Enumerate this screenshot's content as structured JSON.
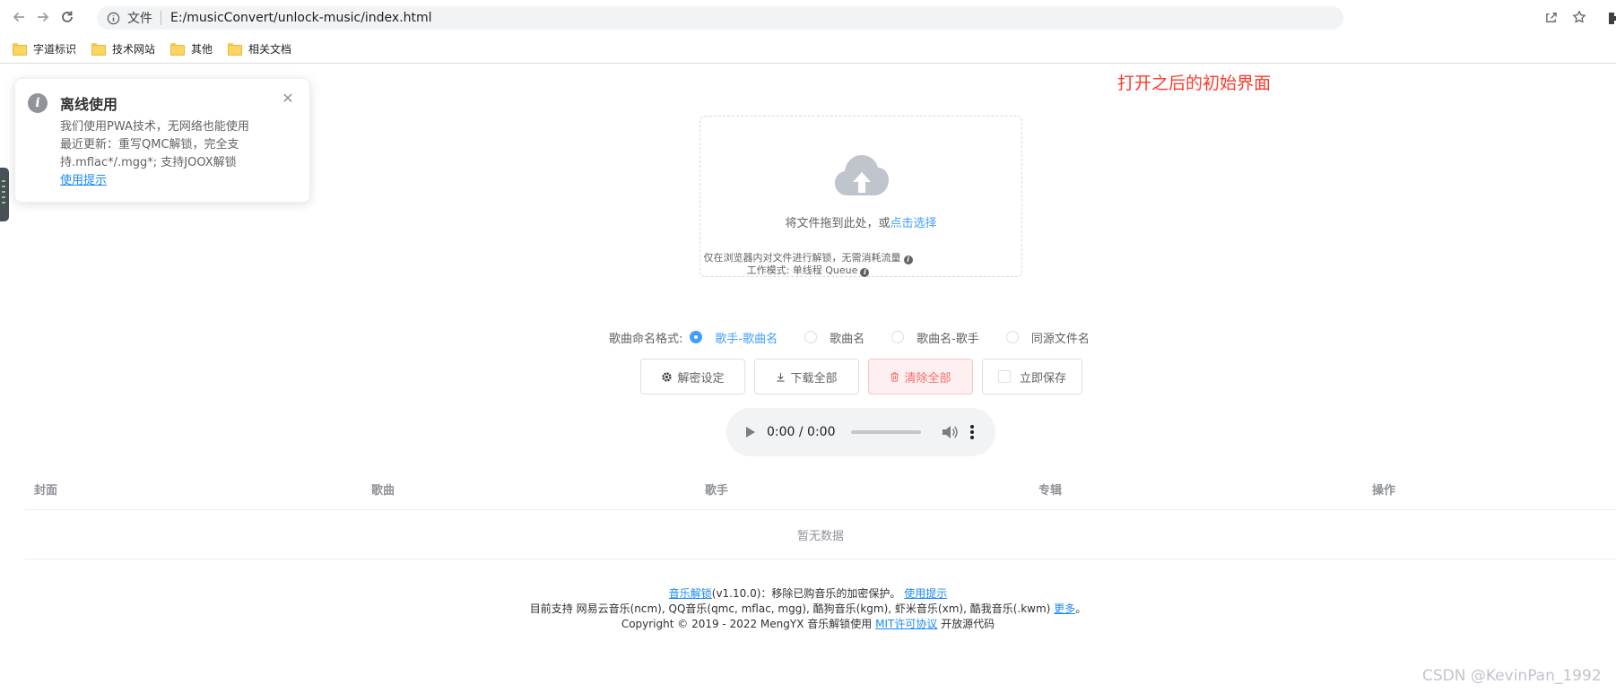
{
  "browser": {
    "scheme_tag": "文件",
    "url": "E:/musicConvert/unlock-music/index.html",
    "bookmarks": [
      "字道标识",
      "技术网站",
      "其他",
      "相关文档"
    ]
  },
  "annotation": "打开之后的初始界面",
  "notification": {
    "title": "离线使用",
    "line1": "我们使用PWA技术，无网络也能使用",
    "line2": "最近更新：重写QMC解锁，完全支持.mflac*/.mgg*; 支持JOOX解锁",
    "link": "使用提示"
  },
  "upload": {
    "text": "将文件拖到此处，或",
    "link": "点击选择"
  },
  "tips": {
    "local": "仅在浏览器内对文件进行解锁，无需消耗流量",
    "mode": "工作模式: 单线程 Queue"
  },
  "naming": {
    "label": "歌曲命名格式:",
    "options": [
      "歌手-歌曲名",
      "歌曲名",
      "歌曲名-歌手",
      "同源文件名"
    ],
    "selected": "歌手-歌曲名"
  },
  "buttons": {
    "settings": "解密设定",
    "download_all": "下载全部",
    "clear_all": "清除全部",
    "save_now": "立即保存"
  },
  "player": {
    "time": "0:00 / 0:00"
  },
  "table": {
    "columns": [
      "封面",
      "歌曲",
      "歌手",
      "专辑",
      "操作"
    ],
    "empty": "暂无数据"
  },
  "footer": {
    "app_link": "音乐解锁",
    "version": "(v1.10.0)：移除已购音乐的加密保护。",
    "tips_link": "使用提示",
    "support": "目前支持 网易云音乐(ncm), QQ音乐(qmc, mflac, mgg), 酷狗音乐(kgm), 虾米音乐(xm), 酷我音乐(.kwm)",
    "more_link": "更多",
    "more_suffix": "。",
    "copyright": "Copyright © 2019 - 2022 MengYX 音乐解锁使用",
    "license_link": "MIT许可协议",
    "opensource": "开放源代码"
  },
  "watermark": "CSDN @KevinPan_1992",
  "colors": {
    "primary": "#409eff",
    "danger": "#f56c6c",
    "annotation": "#ff3a2b"
  }
}
